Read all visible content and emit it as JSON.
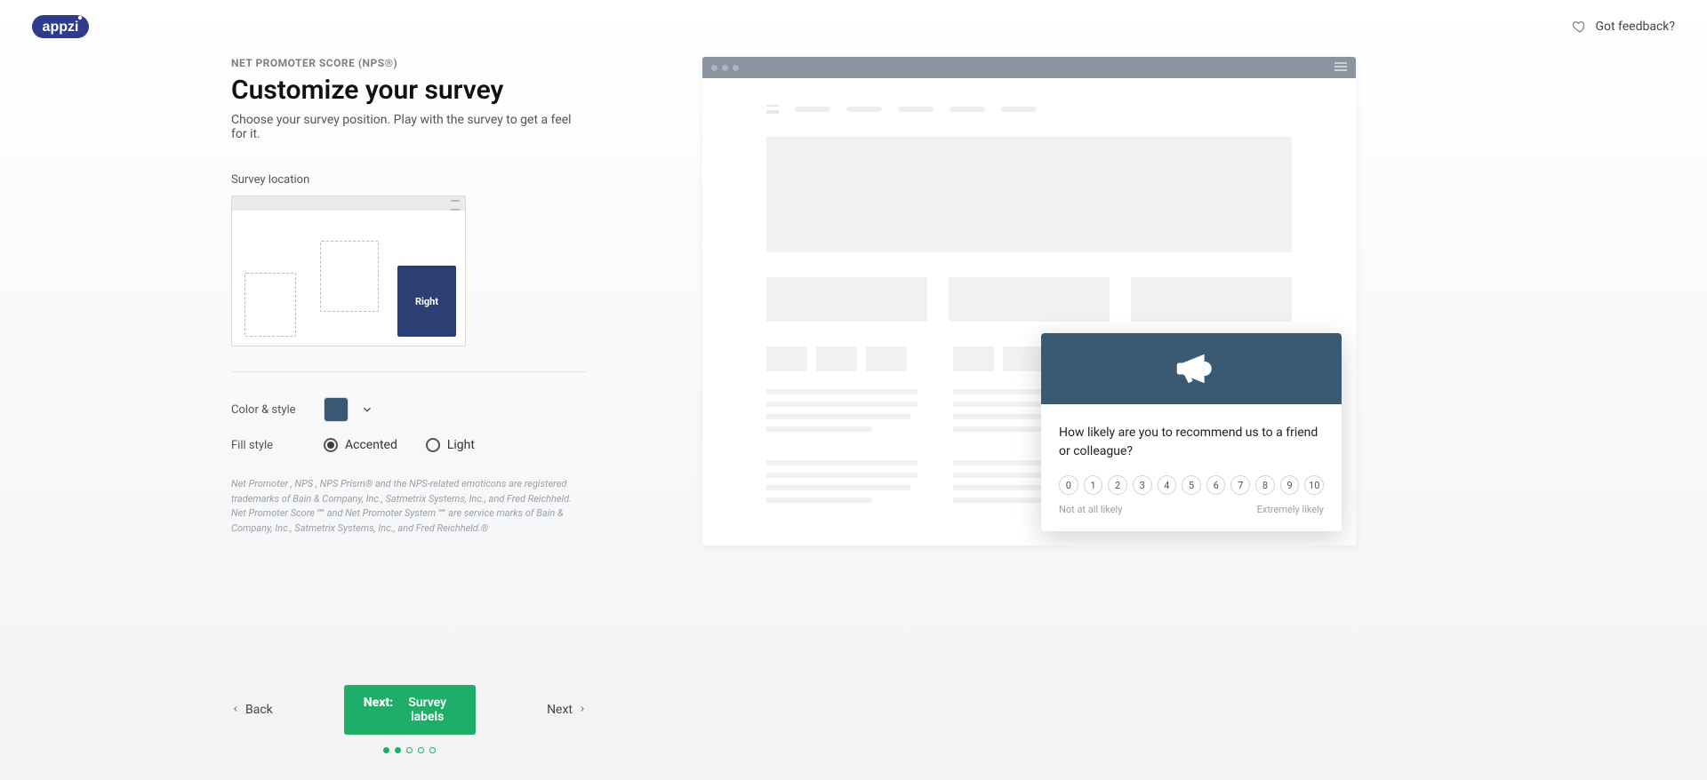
{
  "header": {
    "brand": "appzi",
    "feedback_label": "Got feedback?"
  },
  "left": {
    "kicker": "NET PROMOTER SCORE (NPS®)",
    "title": "Customize your survey",
    "subtitle": "Choose your survey position. Play with the survey to get a feel for it.",
    "survey_location_label": "Survey location",
    "location_options": {
      "left": "",
      "center": "",
      "right": "Right"
    },
    "selected_location": "right",
    "color_style_label": "Color & style",
    "accent_color": "#3a5a74",
    "fill_style_label": "Fill style",
    "fill_options": {
      "accented": "Accented",
      "light": "Light"
    },
    "selected_fill": "accented",
    "trademark": "Net Promoter , NPS , NPS Prism® and the NPS-related emoticons are registered trademarks of Bain & Company, Inc., Satmetrix Systems, Inc., and Fred Reichheld. Net Promoter Score℠ and Net Promoter System℠ are service marks of Bain & Company, Inc., Satmetrix Systems, Inc., and Fred Reichheld.®"
  },
  "survey": {
    "question": "How likely are you to recommend us to a friend or colleague?",
    "scale": [
      "0",
      "1",
      "2",
      "3",
      "4",
      "5",
      "6",
      "7",
      "8",
      "9",
      "10"
    ],
    "low_label": "Not at all likely",
    "high_label": "Extremely likely"
  },
  "wizard": {
    "back": "Back",
    "primary_prefix": "Next:",
    "primary_label": "Survey labels",
    "next": "Next",
    "total_steps": 5,
    "current_step": 2
  }
}
